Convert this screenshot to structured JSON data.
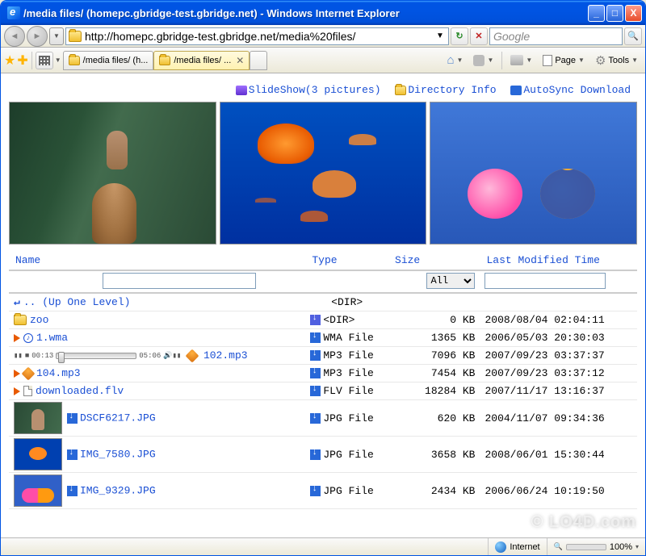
{
  "window": {
    "title": "/media files/ (homepc.gbridge-test.gbridge.net) - Windows Internet Explorer"
  },
  "address": {
    "url": "http://homepc.gbridge-test.gbridge.net/media%20files/"
  },
  "search": {
    "placeholder": "Google"
  },
  "tabs": {
    "inactive": "/media files/ (h...",
    "active": "/media files/ ..."
  },
  "menu": {
    "page": "Page",
    "tools": "Tools"
  },
  "actions": {
    "slideshow": "SlideShow(3 pictures)",
    "dirinfo": "Directory Info",
    "autosync": "AutoSync Download"
  },
  "columns": {
    "name": "Name",
    "type": "Type",
    "size": "Size",
    "modified": "Last Modified Time"
  },
  "filters": {
    "size_all": "All"
  },
  "rows": {
    "up": {
      "name": ".. (Up One Level)",
      "type": "<DIR>"
    },
    "zoo": {
      "name": "zoo",
      "type": "<DIR>",
      "size": "0 KB",
      "mod": "2008/08/04 02:04:11"
    },
    "wma": {
      "name": "1.wma",
      "type": "WMA File",
      "size": "1365 KB",
      "mod": "2006/05/03 20:30:03"
    },
    "mp3a": {
      "name": "102.mp3",
      "type": "MP3 File",
      "size": "7096 KB",
      "mod": "2007/09/23 03:37:37",
      "t0": "00:13",
      "t1": "05:06"
    },
    "mp3b": {
      "name": "104.mp3",
      "type": "MP3 File",
      "size": "7454 KB",
      "mod": "2007/09/23 03:37:12"
    },
    "flv": {
      "name": "downloaded.flv",
      "type": "FLV File",
      "size": "18284 KB",
      "mod": "2007/11/17 13:16:37"
    },
    "img1": {
      "name": "DSCF6217.JPG",
      "type": "JPG File",
      "size": "620 KB",
      "mod": "2004/11/07 09:34:36"
    },
    "img2": {
      "name": "IMG_7580.JPG",
      "type": "JPG File",
      "size": "3658 KB",
      "mod": "2008/06/01 15:30:44"
    },
    "img3": {
      "name": "IMG_9329.JPG",
      "type": "JPG File",
      "size": "2434 KB",
      "mod": "2006/06/24 10:19:50"
    }
  },
  "status": {
    "zone": "Internet",
    "zoom": "100%"
  }
}
